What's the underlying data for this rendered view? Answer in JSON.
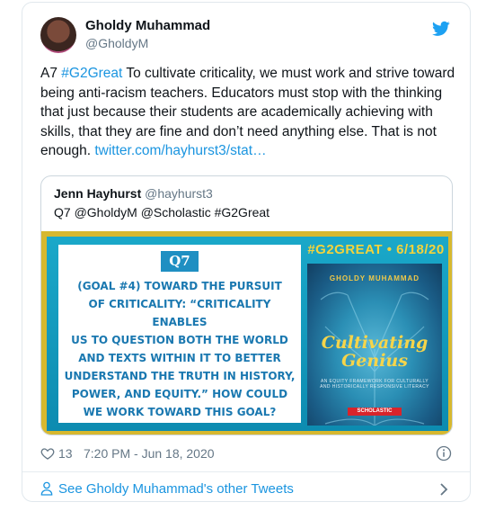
{
  "author": {
    "name": "Gholdy Muhammad",
    "handle": "@GholdyM"
  },
  "tweet": {
    "prefix": "A7 ",
    "hashtag": "#G2Great",
    "body": " To cultivate criticality, we must work and strive toward being anti-racism teachers. Educators must stop with the thinking that just because their students are academically achieving with skills, that they are fine and don’t need anything else. That is not enough. ",
    "link": "twitter.com/hayhurst3/stat…"
  },
  "quote": {
    "name": "Jenn Hayhurst",
    "handle": "@hayhurst3",
    "text": "Q7 @GholdyM @Scholastic #G2Great",
    "image": {
      "badge": "Q7",
      "question_lines": [
        "(GOAL #4) TOWARD THE PURSUIT",
        "OF CRITICALITY: “CRITICALITY ENABLES",
        "US TO QUESTION BOTH THE WORLD",
        "AND TEXTS WITHIN IT TO BETTER",
        "UNDERSTAND THE TRUTH IN HISTORY,",
        "POWER, AND EQUITY.” HOW COULD",
        "WE WORK TOWARD THIS GOAL?"
      ],
      "hashtag_date": "#G2GREAT • 6/18/20",
      "book_author": "GHOLDY MUHAMMAD",
      "book_title_1": "Cultivating",
      "book_title_2": "Genius",
      "book_subtitle": "AN EQUITY FRAMEWORK FOR CULTURALLY AND HISTORICALLY RESPONSIVE LITERACY",
      "publisher": "SCHOLASTIC"
    }
  },
  "meta": {
    "likes": "13",
    "timestamp": "7:20 PM - Jun 18, 2020"
  },
  "footer": {
    "label": "See Gholdy Muhammad's other Tweets"
  },
  "colors": {
    "link": "#1b95e0",
    "muted": "#657786",
    "border": "#e1e8ed",
    "frame": "#d7b82e",
    "panel": "#1aa8c9"
  },
  "icons": {
    "logo": "twitter-bird-icon",
    "like": "heart-icon",
    "info": "info-icon",
    "person": "person-icon",
    "chevron": "chevron-right-icon"
  }
}
